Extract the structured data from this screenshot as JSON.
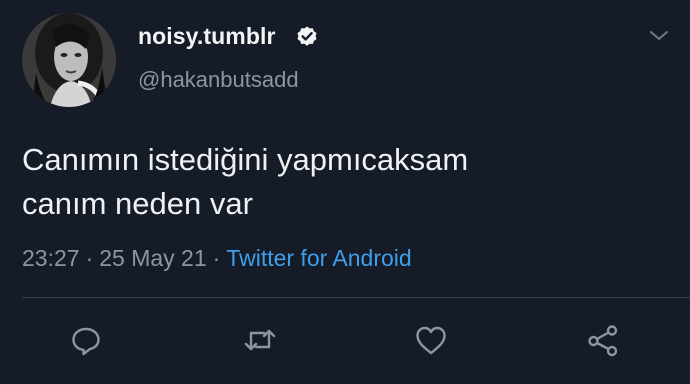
{
  "tweet": {
    "display_name": "noisy.tumblr",
    "handle": "@hakanbutsadd",
    "verified": true,
    "text_line1": "Canımın istediğini yapmıcaksam",
    "text_line2": "canım neden var",
    "time": "23:27",
    "date": "25 May 21",
    "separator": "·",
    "source": "Twitter for Android"
  },
  "actions": {
    "reply_icon": "reply-icon",
    "retweet_icon": "retweet-icon",
    "like_icon": "heart-icon",
    "share_icon": "share-icon"
  },
  "colors": {
    "background": "#151c27",
    "text": "#eef1f4",
    "muted": "#8a97a3",
    "link": "#3f9ee8",
    "divider": "#38444d"
  }
}
